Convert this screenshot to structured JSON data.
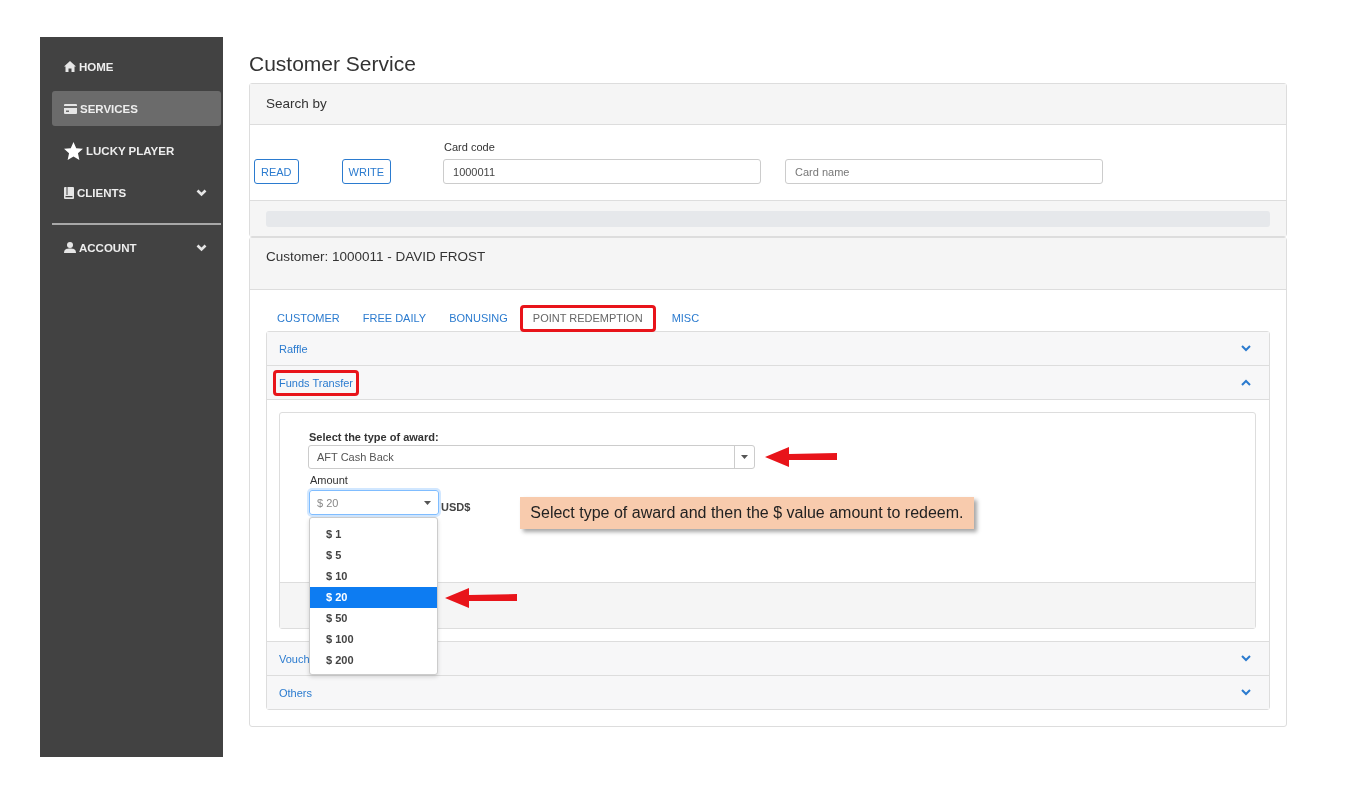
{
  "sidebar": {
    "sections": [
      {
        "items": [
          {
            "label": "HOME",
            "kind": "link",
            "selected": false
          },
          {
            "label": "SERVICES",
            "kind": "link",
            "selected": true
          },
          {
            "label": "LUCKY PLAYER",
            "kind": "link",
            "selected": false
          },
          {
            "label": "CLIENTS",
            "kind": "group",
            "selected": false
          }
        ]
      },
      {
        "items": [
          {
            "label": "ACCOUNT",
            "kind": "group",
            "selected": false
          }
        ]
      }
    ]
  },
  "page_title": "Customer Service",
  "search_panel": {
    "header": "Search by",
    "buttons": [
      {
        "label": "READ"
      },
      {
        "label": "WRITE"
      }
    ],
    "fields": [
      {
        "label": "Card code",
        "value": "1000011"
      },
      {
        "placeholder": "Card name"
      }
    ]
  },
  "customer_panel": {
    "header": "Customer: 1000011 - DAVID FROST",
    "tabs": [
      {
        "label": "CUSTOMER",
        "selected": false,
        "highlighted": false
      },
      {
        "label": "FREE DAILY",
        "selected": false,
        "highlighted": false
      },
      {
        "label": "BONUSING",
        "selected": false,
        "highlighted": false
      },
      {
        "label": "POINT REDEMPTION",
        "selected": true,
        "highlighted": true
      },
      {
        "label": "MISC",
        "selected": false,
        "highlighted": false
      }
    ],
    "accordion": [
      {
        "title": "Raffle",
        "expanded": false,
        "highlighted": false
      },
      {
        "title": "Funds Transfer",
        "expanded": true,
        "highlighted": true,
        "form": {
          "award": {
            "label": "Select the type of award:",
            "value": "AFT Cash Back",
            "arrow": true
          },
          "amount": {
            "label": "Amount",
            "value": "$ 20",
            "unit": "USD$",
            "open": true,
            "options": [
              {
                "label": "$ 1",
                "selected": false,
                "arrow": false
              },
              {
                "label": "$ 5",
                "selected": false,
                "arrow": false
              },
              {
                "label": "$ 10",
                "selected": false,
                "arrow": false
              },
              {
                "label": "$ 20",
                "selected": true,
                "arrow": true
              },
              {
                "label": "$ 50",
                "selected": false,
                "arrow": false
              },
              {
                "label": "$ 100",
                "selected": false,
                "arrow": false
              },
              {
                "label": "$ 200",
                "selected": false,
                "arrow": false
              }
            ]
          },
          "callout": "Select type of award and then the $ value amount to redeem."
        }
      },
      {
        "title": "Vouch",
        "expanded": false,
        "highlighted": false
      },
      {
        "title": "Others",
        "expanded": false,
        "highlighted": false
      }
    ]
  }
}
